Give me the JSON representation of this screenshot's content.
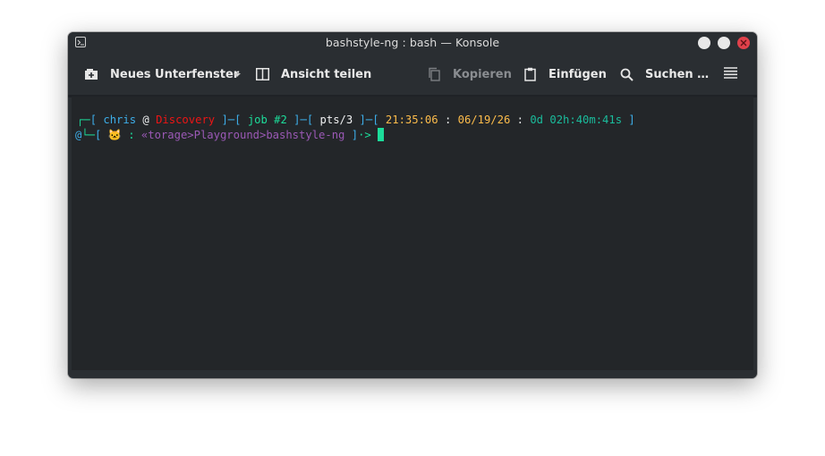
{
  "window": {
    "title": "bashstyle-ng : bash — Konsole",
    "controls": [
      "minimize",
      "maximize",
      "close"
    ]
  },
  "toolbar": {
    "new_tab_label": "Neues Unterfenster",
    "split_view_label": "Ansicht teilen",
    "copy_label": "Kopieren",
    "paste_label": "Einfügen",
    "find_label": "Suchen …"
  },
  "terminal": {
    "line1": {
      "frame": "┌─",
      "open": "[ ",
      "user": "chris",
      "at": " @ ",
      "host": "Discovery",
      "sep1": " ]─[ ",
      "job": "job #2",
      "sep2": " ]─[ ",
      "pts": "pts/3",
      "sep3": " ]─[ ",
      "time": "21:35:06",
      "colon1": " : ",
      "date": "06/19/26",
      "colon2": " : ",
      "uptime": "0d 02h:40m:41s",
      "close": " ]"
    },
    "line2": {
      "at_sign": "@",
      "frame": "└─",
      "open": "[ ",
      "emoji": "🐱",
      "colon": " : ",
      "path": "«torage>Playground>bashstyle-ng",
      "close": " ]",
      "arrow": "·>",
      "space": " "
    }
  },
  "colors": {
    "window_bg": "#2a2e32",
    "terminal_bg": "#232629",
    "accent_blue": "#3daee9",
    "frame_green": "#1cdc9a",
    "host_red": "#ed1515",
    "time_yellow": "#fdbc4b",
    "path_purple": "#9b59b6",
    "close_red": "#e0414b"
  },
  "icons": [
    "terminal-app-icon",
    "new-tab-icon",
    "chevron-down-icon",
    "split-view-icon",
    "copy-icon",
    "paste-icon",
    "search-icon",
    "hamburger-menu-icon"
  ]
}
